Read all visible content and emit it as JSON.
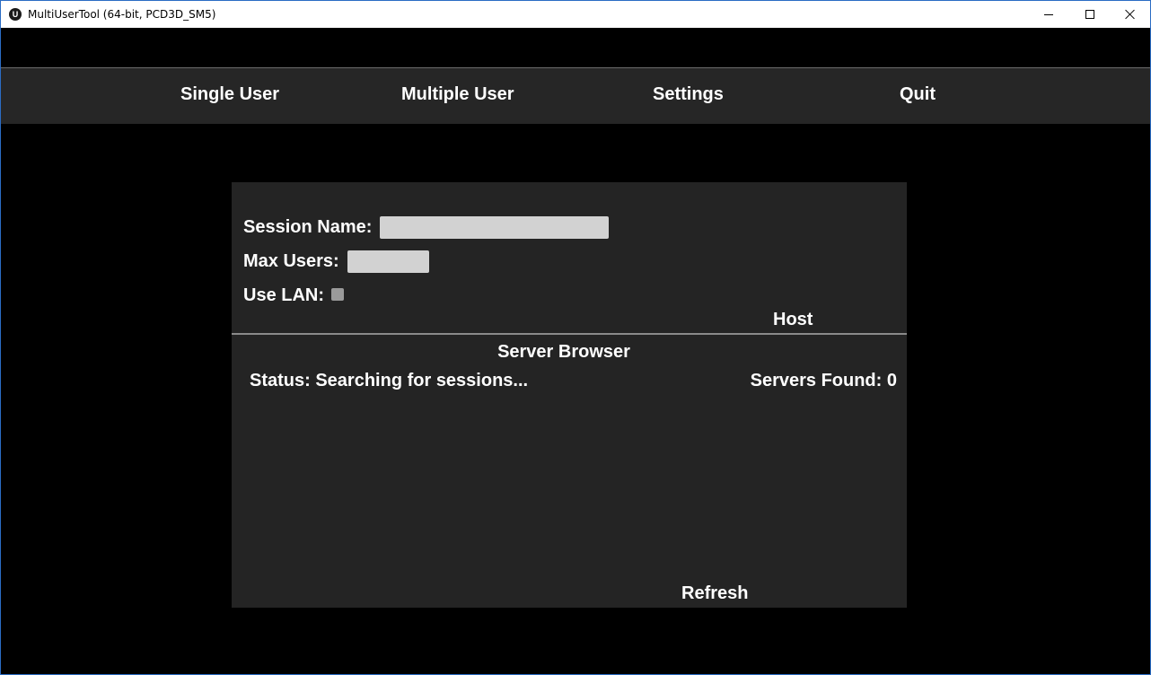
{
  "window": {
    "title": "MultiUserTool (64-bit, PCD3D_SM5)",
    "icon": "unreal-engine-logo",
    "icon_glyph": "U"
  },
  "nav": {
    "items": [
      {
        "label": "Single User"
      },
      {
        "label": "Multiple User"
      },
      {
        "label": "Settings"
      },
      {
        "label": "Quit"
      }
    ]
  },
  "host_form": {
    "session_name_label": "Session Name:",
    "session_name_value": "",
    "max_users_label": "Max Users:",
    "max_users_value": "",
    "use_lan_label": "Use LAN:",
    "use_lan_checked": false,
    "host_label": "Host"
  },
  "server_browser": {
    "title": "Server Browser",
    "status": "Status: Searching for sessions...",
    "servers_found": "Servers Found: 0",
    "servers": [],
    "refresh_label": "Refresh"
  },
  "colors": {
    "background": "#000000",
    "navbar": "#262626",
    "panel": "#242424",
    "input": "#d2d2d2",
    "text": "#ffffff"
  }
}
